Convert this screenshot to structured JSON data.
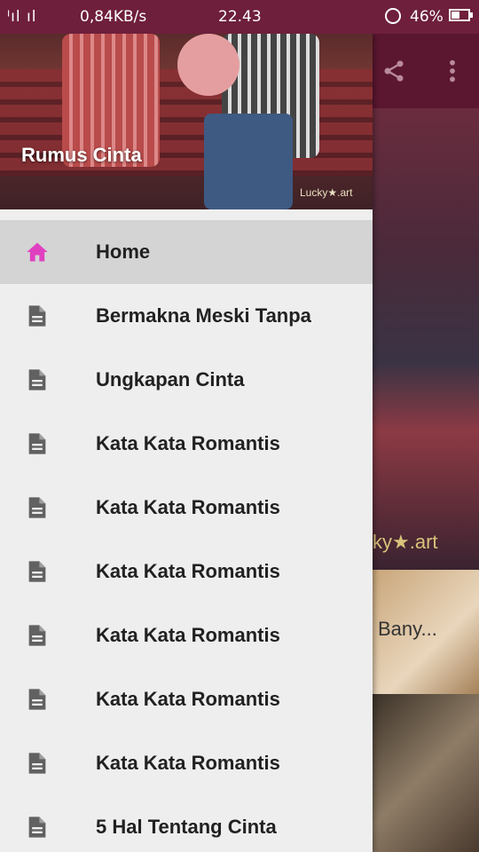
{
  "status_bar": {
    "signal": "3ılı .ılı",
    "speed": "0,84KB/s",
    "time": "22.43",
    "battery": "46%"
  },
  "background": {
    "watermark": "ky★.art",
    "card_title": "Bany..."
  },
  "drawer": {
    "header_title": "Rumus Cinta",
    "header_watermark": "Lucky★.art",
    "items": [
      {
        "label": "Home",
        "icon": "home-icon"
      },
      {
        "label": "Bermakna Meski Tanpa",
        "icon": "document-icon"
      },
      {
        "label": "Ungkapan Cinta",
        "icon": "document-icon"
      },
      {
        "label": "Kata Kata Romantis",
        "icon": "document-icon"
      },
      {
        "label": "Kata Kata Romantis",
        "icon": "document-icon"
      },
      {
        "label": "Kata Kata Romantis",
        "icon": "document-icon"
      },
      {
        "label": "Kata Kata Romantis",
        "icon": "document-icon"
      },
      {
        "label": "Kata Kata Romantis",
        "icon": "document-icon"
      },
      {
        "label": "Kata Kata Romantis",
        "icon": "document-icon"
      },
      {
        "label": "5 Hal Tentang Cinta",
        "icon": "document-icon"
      }
    ]
  },
  "colors": {
    "status_bar": "#6e1f3b",
    "accent": "#e040c0",
    "icon_gray": "#616161",
    "active_bg": "#d4d4d4"
  }
}
